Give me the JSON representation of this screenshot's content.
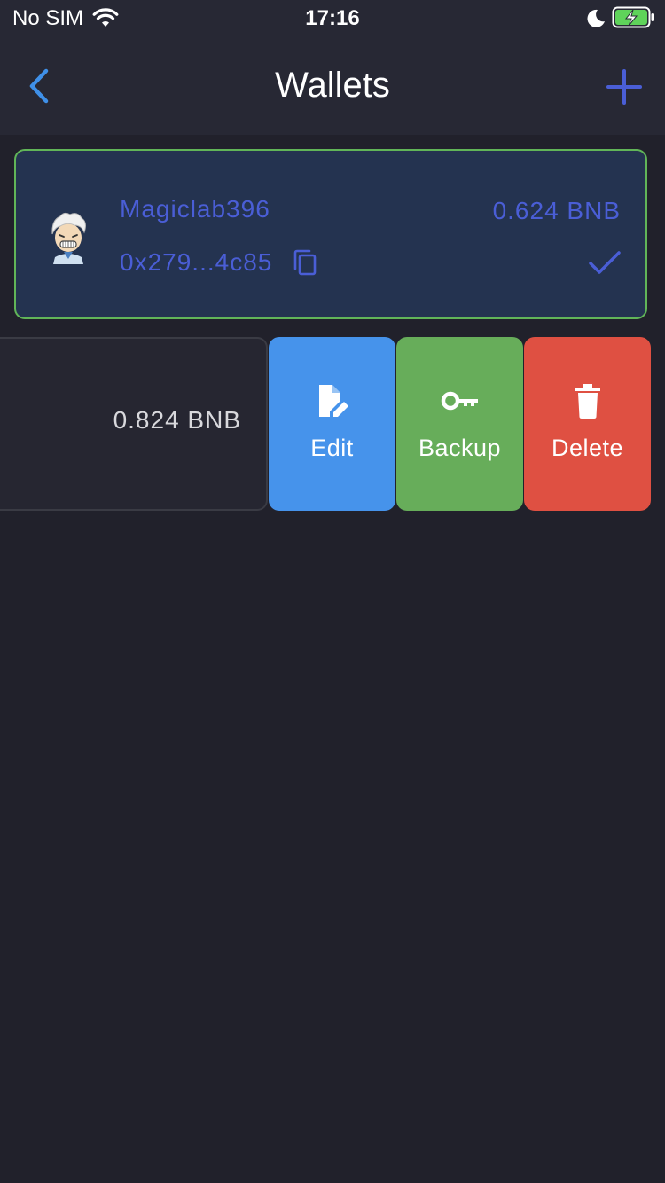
{
  "status_bar": {
    "carrier": "No SIM",
    "time": "17:16"
  },
  "nav": {
    "title": "Wallets"
  },
  "wallets": [
    {
      "name": "Magiclab396",
      "balance": "0.624 BNB",
      "address": "0x279...4c85",
      "selected": true
    },
    {
      "balance": "0.824 BNB"
    }
  ],
  "actions": {
    "edit": "Edit",
    "backup": "Backup",
    "delete": "Delete"
  },
  "colors": {
    "background": "#21212b",
    "header": "#272834",
    "accent": "#4a5ed6",
    "selected_border": "#61b558",
    "edit": "#4693eb",
    "backup": "#67ad5a",
    "delete": "#df5042"
  },
  "icons": {
    "back": "chevron-left-icon",
    "add": "plus-icon",
    "copy": "copy-icon",
    "selected": "check-icon",
    "edit": "edit-document-icon",
    "backup": "key-icon",
    "delete": "trash-icon"
  }
}
